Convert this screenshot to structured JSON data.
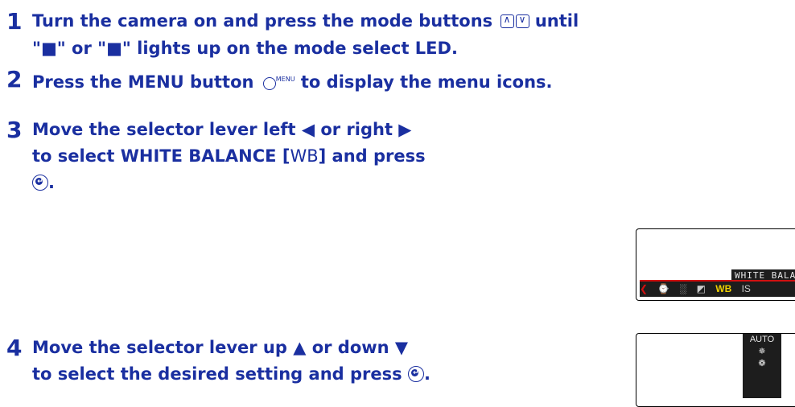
{
  "steps": [
    {
      "num": "1",
      "line1_a": "Turn the camera on and press the mode buttons",
      "line1_b": "until",
      "line2": "\"■\" or \"■\" lights up on the mode select LED.",
      "icons": [
        "mode-up-button-icon",
        "mode-down-button-icon"
      ]
    },
    {
      "num": "2",
      "text_a": "Press the MENU button",
      "menu_sup": "MENU",
      "text_b": "to display the menu icons."
    },
    {
      "num": "3",
      "line1_a": "Move the selector lever left",
      "arrow_left": "◀",
      "line1_mid": "or right",
      "arrow_right": "▶",
      "line2_a": "to select WHITE BALANCE [",
      "line2_wb": "WB",
      "line2_b": "] and press",
      "line3": "."
    },
    {
      "num": "4",
      "line1_a": "Move the selector lever up",
      "arrow_up": "▲",
      "line1_mid": "or down",
      "arrow_down": "▼",
      "line2_a": "to select the desired setting and press",
      "line2_b": "."
    }
  ],
  "screen1": {
    "title": "WHITE BALAN",
    "icons": [
      "❮",
      "⌚",
      "░",
      "◩",
      "WB",
      "IS"
    ]
  },
  "screen2": {
    "items": [
      "AUTO",
      "✵",
      "❁"
    ]
  },
  "colors": {
    "text": "#1a2fa0",
    "accent_red": "#d01010",
    "lcd_bg": "#1d1d1d",
    "wb_highlight": "#f0d000"
  }
}
